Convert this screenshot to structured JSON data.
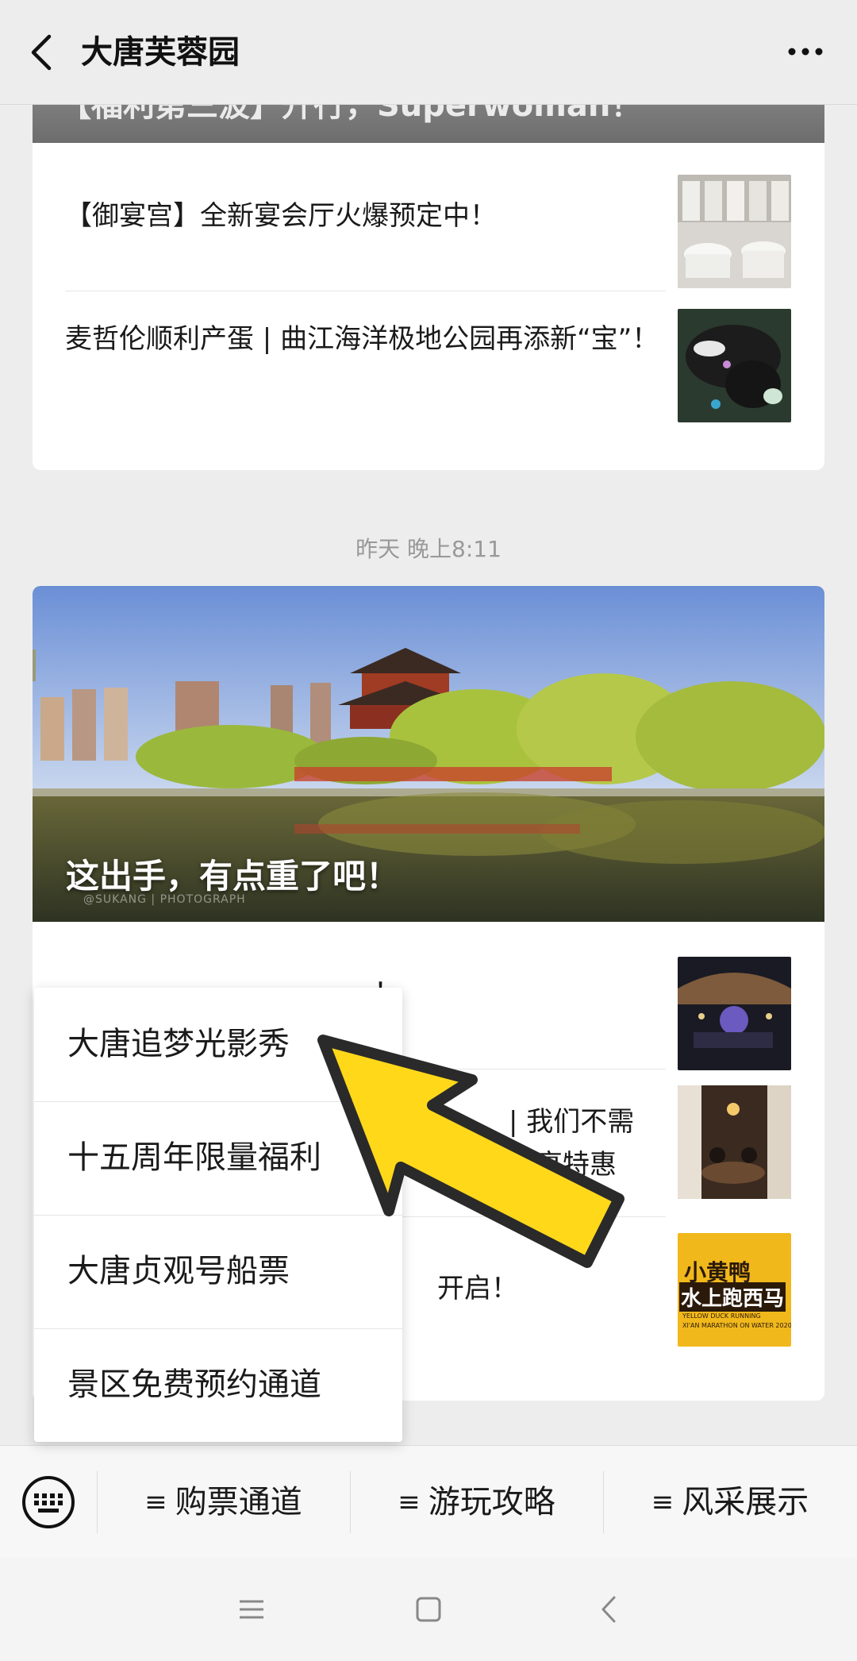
{
  "header": {
    "title": "大唐芙蓉园",
    "back_icon": "chevron-left-icon",
    "more_icon": "more-horizontal-icon"
  },
  "feed": {
    "card1": {
      "banner_tail_title": "【福利第三波】升行，Superwoman！",
      "items": [
        {
          "title": "【御宴宫】全新宴会厅火爆预定中！"
        },
        {
          "title": "麦哲伦顺利产蛋 | 曲江海洋极地公园再添新“宝”！"
        }
      ]
    },
    "timestamp": "昨天 晚上8:11",
    "card2": {
      "hero_title": "这出手，有点重了吧！",
      "hero_watermark": "@SUKANG | PHOTOGRAPH",
      "items": [
        {
          "title_visible": "！"
        },
        {
          "title_visible_a": "| 我们不需",
          "title_visible_b": "可享特惠"
        },
        {
          "title_visible": "开启！",
          "thumb_text_1": "小黄鸭",
          "thumb_text_2": "水上跑西马",
          "thumb_text_3": "YELLOW DUCK RUNNING",
          "thumb_text_4": "XI'AN MARATHON ON WATER 2020"
        }
      ]
    }
  },
  "popup_menu": {
    "items": [
      "大唐追梦光影秀",
      "十五周年限量福利",
      "大唐贞观号船票",
      "景区免费预约通道"
    ]
  },
  "menubar": {
    "keyboard_icon": "keyboard-icon",
    "menus": [
      "购票通道",
      "游玩攻略",
      "风采展示"
    ]
  },
  "navbar": {
    "icons": [
      "menu-icon",
      "home-square-icon",
      "back-triangle-icon"
    ]
  },
  "colors": {
    "arrow_fill": "#ffd81a",
    "background": "#ededed",
    "card": "#ffffff"
  }
}
